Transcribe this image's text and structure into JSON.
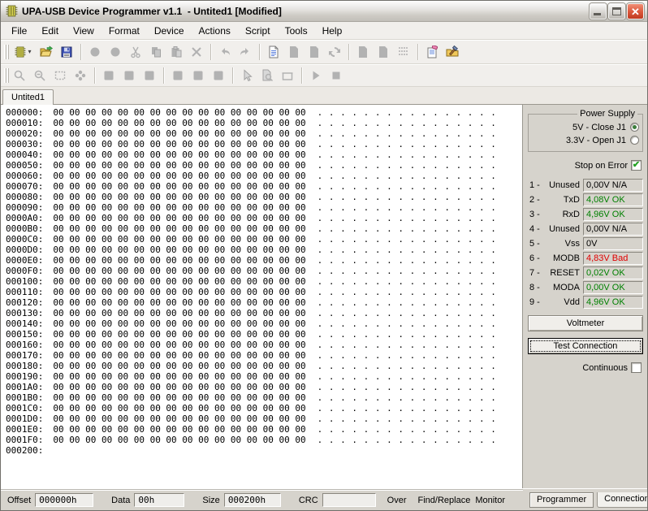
{
  "window": {
    "title": "UPA-USB Device Programmer v1.1  - Untited1 [Modified]",
    "icon": "chip-icon"
  },
  "titlebar": {
    "minimize_icon": "minimize-icon",
    "maximize_icon": "maximize-icon",
    "close_icon": "close-icon"
  },
  "menu": {
    "items": [
      "File",
      "Edit",
      "View",
      "Format",
      "Device",
      "Actions",
      "Script",
      "Tools",
      "Help"
    ]
  },
  "toolbars": {
    "row1": {
      "groups": [
        {
          "buttons": [
            {
              "icon": "new-chip-icon",
              "enabled": true,
              "has_dropdown": true
            },
            {
              "icon": "open-folder-icon",
              "enabled": true
            },
            {
              "icon": "save-floppy-icon",
              "enabled": true
            }
          ]
        },
        {
          "buttons": [
            {
              "icon": "circle-icon",
              "enabled": false
            },
            {
              "icon": "circle-icon",
              "enabled": false
            },
            {
              "icon": "cut-scissors-icon",
              "enabled": false
            },
            {
              "icon": "copy-icon",
              "enabled": false
            },
            {
              "icon": "paste-icon",
              "enabled": false
            },
            {
              "icon": "delete-x-icon",
              "enabled": false
            }
          ]
        },
        {
          "buttons": [
            {
              "icon": "undo-icon",
              "enabled": false
            },
            {
              "icon": "redo-icon",
              "enabled": false
            }
          ]
        },
        {
          "buttons": [
            {
              "icon": "document-lines-icon",
              "enabled": true
            },
            {
              "icon": "document-icon",
              "enabled": false
            },
            {
              "icon": "document-icon",
              "enabled": false
            },
            {
              "icon": "refresh-icon",
              "enabled": false
            }
          ]
        },
        {
          "buttons": [
            {
              "icon": "document-icon",
              "enabled": false
            },
            {
              "icon": "document-icon",
              "enabled": false
            },
            {
              "icon": "dot-grid-icon",
              "enabled": false
            }
          ]
        },
        {
          "buttons": [
            {
              "icon": "notepad-eraser-icon",
              "enabled": true
            },
            {
              "icon": "folder-tools-icon",
              "enabled": true
            }
          ]
        }
      ]
    },
    "row2": {
      "groups": [
        {
          "buttons": [
            {
              "icon": "zoom-in-icon",
              "enabled": false
            },
            {
              "icon": "zoom-out-icon",
              "enabled": false
            },
            {
              "icon": "select-frame-icon",
              "enabled": false
            },
            {
              "icon": "flower-icon",
              "enabled": false
            }
          ]
        },
        {
          "buttons": [
            {
              "icon": "square-icon",
              "enabled": false
            },
            {
              "icon": "square-icon",
              "enabled": false
            },
            {
              "icon": "square-icon",
              "enabled": false
            }
          ]
        },
        {
          "buttons": [
            {
              "icon": "square-icon",
              "enabled": false
            },
            {
              "icon": "square-icon",
              "enabled": false
            },
            {
              "icon": "square-icon",
              "enabled": false
            }
          ]
        },
        {
          "buttons": [
            {
              "icon": "cursor-arrow-icon",
              "enabled": false
            },
            {
              "icon": "find-document-icon",
              "enabled": false
            },
            {
              "icon": "box-icon",
              "enabled": false
            }
          ]
        },
        {
          "buttons": [
            {
              "icon": "play-icon",
              "enabled": false
            },
            {
              "icon": "stop-icon",
              "enabled": false
            }
          ]
        }
      ]
    }
  },
  "document_tabs": {
    "active": "Untited1"
  },
  "hex_editor": {
    "byte_line": "00 00 00 00 00 00 00 00 00 00 00 00 00 00 00 00",
    "ascii_line": ". . . . . . . . . . . . . . . .",
    "rows": [
      {
        "addr": "000000:",
        "bytes": "00 00 00 00 00 00 00 00 00 00 00 00 00 00 00 00",
        "ascii": ". . . . . . . . . . . . . . . ."
      },
      {
        "addr": "000010:",
        "bytes": "00 00 00 00 00 00 00 00 00 00 00 00 00 00 00 00",
        "ascii": ". . . . . . . . . . . . . . . ."
      },
      {
        "addr": "000020:",
        "bytes": "00 00 00 00 00 00 00 00 00 00 00 00 00 00 00 00",
        "ascii": ". . . . . . . . . . . . . . . ."
      },
      {
        "addr": "000030:",
        "bytes": "00 00 00 00 00 00 00 00 00 00 00 00 00 00 00 00",
        "ascii": ". . . . . . . . . . . . . . . ."
      },
      {
        "addr": "000040:",
        "bytes": "00 00 00 00 00 00 00 00 00 00 00 00 00 00 00 00",
        "ascii": ". . . . . . . . . . . . . . . ."
      },
      {
        "addr": "000050:",
        "bytes": "00 00 00 00 00 00 00 00 00 00 00 00 00 00 00 00",
        "ascii": ". . . . . . . . . . . . . . . ."
      },
      {
        "addr": "000060:",
        "bytes": "00 00 00 00 00 00 00 00 00 00 00 00 00 00 00 00",
        "ascii": ". . . . . . . . . . . . . . . ."
      },
      {
        "addr": "000070:",
        "bytes": "00 00 00 00 00 00 00 00 00 00 00 00 00 00 00 00",
        "ascii": ". . . . . . . . . . . . . . . ."
      },
      {
        "addr": "000080:",
        "bytes": "00 00 00 00 00 00 00 00 00 00 00 00 00 00 00 00",
        "ascii": ". . . . . . . . . . . . . . . ."
      },
      {
        "addr": "000090:",
        "bytes": "00 00 00 00 00 00 00 00 00 00 00 00 00 00 00 00",
        "ascii": ". . . . . . . . . . . . . . . ."
      },
      {
        "addr": "0000A0:",
        "bytes": "00 00 00 00 00 00 00 00 00 00 00 00 00 00 00 00",
        "ascii": ". . . . . . . . . . . . . . . ."
      },
      {
        "addr": "0000B0:",
        "bytes": "00 00 00 00 00 00 00 00 00 00 00 00 00 00 00 00",
        "ascii": ". . . . . . . . . . . . . . . ."
      },
      {
        "addr": "0000C0:",
        "bytes": "00 00 00 00 00 00 00 00 00 00 00 00 00 00 00 00",
        "ascii": ". . . . . . . . . . . . . . . ."
      },
      {
        "addr": "0000D0:",
        "bytes": "00 00 00 00 00 00 00 00 00 00 00 00 00 00 00 00",
        "ascii": ". . . . . . . . . . . . . . . ."
      },
      {
        "addr": "0000E0:",
        "bytes": "00 00 00 00 00 00 00 00 00 00 00 00 00 00 00 00",
        "ascii": ". . . . . . . . . . . . . . . ."
      },
      {
        "addr": "0000F0:",
        "bytes": "00 00 00 00 00 00 00 00 00 00 00 00 00 00 00 00",
        "ascii": ". . . . . . . . . . . . . . . ."
      },
      {
        "addr": "000100:",
        "bytes": "00 00 00 00 00 00 00 00 00 00 00 00 00 00 00 00",
        "ascii": ". . . . . . . . . . . . . . . ."
      },
      {
        "addr": "000110:",
        "bytes": "00 00 00 00 00 00 00 00 00 00 00 00 00 00 00 00",
        "ascii": ". . . . . . . . . . . . . . . ."
      },
      {
        "addr": "000120:",
        "bytes": "00 00 00 00 00 00 00 00 00 00 00 00 00 00 00 00",
        "ascii": ". . . . . . . . . . . . . . . ."
      },
      {
        "addr": "000130:",
        "bytes": "00 00 00 00 00 00 00 00 00 00 00 00 00 00 00 00",
        "ascii": ". . . . . . . . . . . . . . . ."
      },
      {
        "addr": "000140:",
        "bytes": "00 00 00 00 00 00 00 00 00 00 00 00 00 00 00 00",
        "ascii": ". . . . . . . . . . . . . . . ."
      },
      {
        "addr": "000150:",
        "bytes": "00 00 00 00 00 00 00 00 00 00 00 00 00 00 00 00",
        "ascii": ". . . . . . . . . . . . . . . ."
      },
      {
        "addr": "000160:",
        "bytes": "00 00 00 00 00 00 00 00 00 00 00 00 00 00 00 00",
        "ascii": ". . . . . . . . . . . . . . . ."
      },
      {
        "addr": "000170:",
        "bytes": "00 00 00 00 00 00 00 00 00 00 00 00 00 00 00 00",
        "ascii": ". . . . . . . . . . . . . . . ."
      },
      {
        "addr": "000180:",
        "bytes": "00 00 00 00 00 00 00 00 00 00 00 00 00 00 00 00",
        "ascii": ". . . . . . . . . . . . . . . ."
      },
      {
        "addr": "000190:",
        "bytes": "00 00 00 00 00 00 00 00 00 00 00 00 00 00 00 00",
        "ascii": ". . . . . . . . . . . . . . . ."
      },
      {
        "addr": "0001A0:",
        "bytes": "00 00 00 00 00 00 00 00 00 00 00 00 00 00 00 00",
        "ascii": ". . . . . . . . . . . . . . . ."
      },
      {
        "addr": "0001B0:",
        "bytes": "00 00 00 00 00 00 00 00 00 00 00 00 00 00 00 00",
        "ascii": ". . . . . . . . . . . . . . . ."
      },
      {
        "addr": "0001C0:",
        "bytes": "00 00 00 00 00 00 00 00 00 00 00 00 00 00 00 00",
        "ascii": ". . . . . . . . . . . . . . . ."
      },
      {
        "addr": "0001D0:",
        "bytes": "00 00 00 00 00 00 00 00 00 00 00 00 00 00 00 00",
        "ascii": ". . . . . . . . . . . . . . . ."
      },
      {
        "addr": "0001E0:",
        "bytes": "00 00 00 00 00 00 00 00 00 00 00 00 00 00 00 00",
        "ascii": ". . . . . . . . . . . . . . . ."
      },
      {
        "addr": "0001F0:",
        "bytes": "00 00 00 00 00 00 00 00 00 00 00 00 00 00 00 00",
        "ascii": ". . . . . . . . . . . . . . . ."
      },
      {
        "addr": "000200:",
        "bytes": "",
        "ascii": ""
      }
    ]
  },
  "right_panel": {
    "power_supply": {
      "title": "Power Supply",
      "options": [
        {
          "label": "5V - Close J1",
          "selected": true
        },
        {
          "label": "3.3V - Open J1",
          "selected": false
        }
      ]
    },
    "stop_on_error": {
      "label": "Stop on Error",
      "checked": true
    },
    "pins": [
      {
        "num": "1 -",
        "name": "Unused",
        "value": "0,00V N/A",
        "status": "na"
      },
      {
        "num": "2 -",
        "name": "TxD",
        "value": "4,08V OK",
        "status": "ok"
      },
      {
        "num": "3 -",
        "name": "RxD",
        "value": "4,96V OK",
        "status": "ok"
      },
      {
        "num": "4 -",
        "name": "Unused",
        "value": "0,00V N/A",
        "status": "na"
      },
      {
        "num": "5 -",
        "name": "Vss",
        "value": "0V",
        "status": "na"
      },
      {
        "num": "6 -",
        "name": "MODB",
        "value": "4,83V Bad",
        "status": "bad"
      },
      {
        "num": "7 -",
        "name": "RESET",
        "value": "0,02V OK",
        "status": "ok"
      },
      {
        "num": "8 -",
        "name": "MODA",
        "value": "0,00V OK",
        "status": "ok"
      },
      {
        "num": "9 -",
        "name": "Vdd",
        "value": "4,96V OK",
        "status": "ok"
      }
    ],
    "voltmeter_button": "Voltmeter",
    "test_connection_button": "Test Connection",
    "continuous": {
      "label": "Continuous",
      "checked": false
    }
  },
  "status_bar": {
    "offset_label": "Offset",
    "offset_value": "000000h",
    "data_label": "Data",
    "data_value": "00h",
    "size_label": "Size",
    "size_value": "000200h",
    "crc_label": "CRC",
    "crc_value": "",
    "over_label": "Over",
    "find_replace_label": "Find/Replace",
    "monitor_label": "Monitor"
  },
  "bottom_tabs": {
    "active": "Programmer",
    "inactive": "Connections"
  },
  "colors": {
    "ok_green": "#008000",
    "bad_red": "#e00000",
    "titlebar_silver": "#d8d6d2",
    "close_red": "#dd5a3e",
    "chip_yellow": "#f5ef5a"
  }
}
